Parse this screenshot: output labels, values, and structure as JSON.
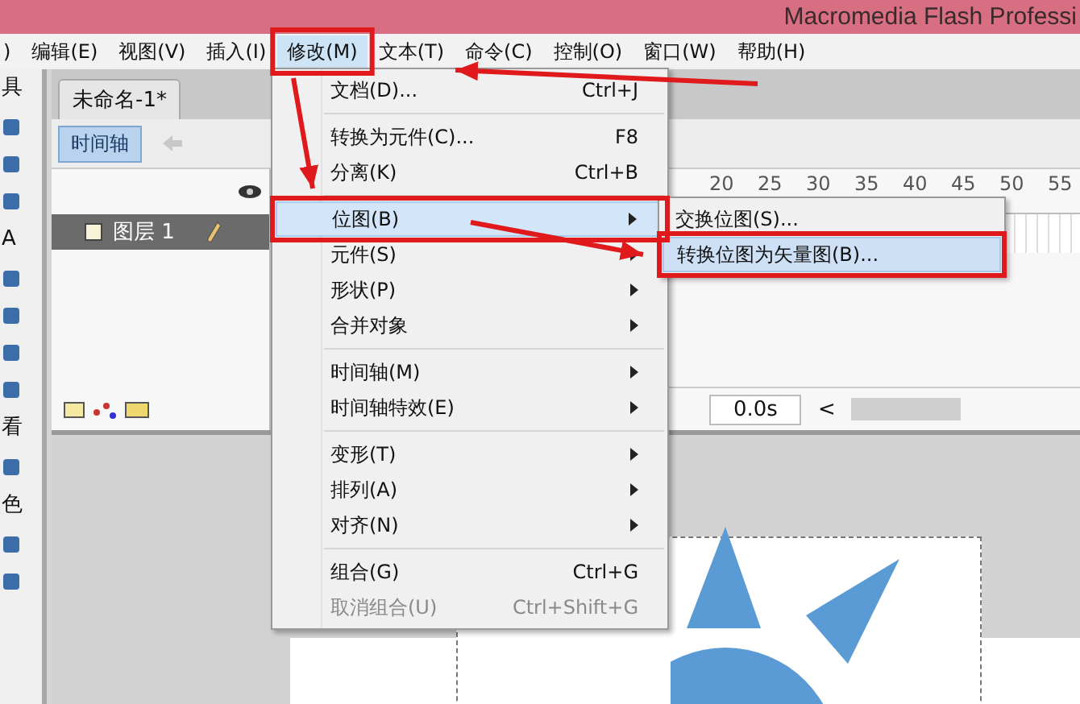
{
  "window": {
    "title": "Macromedia Flash Professi"
  },
  "menubar": [
    {
      "label": ")",
      "selected": false
    },
    {
      "label": "编辑(E)",
      "selected": false
    },
    {
      "label": "视图(V)",
      "selected": false
    },
    {
      "label": "插入(I)",
      "selected": false
    },
    {
      "label": "修改(M)",
      "selected": true
    },
    {
      "label": "文本(T)",
      "selected": false
    },
    {
      "label": "命令(C)",
      "selected": false
    },
    {
      "label": "控制(O)",
      "selected": false
    },
    {
      "label": "窗口(W)",
      "selected": false
    },
    {
      "label": "帮助(H)",
      "selected": false
    }
  ],
  "toolbox": [
    {
      "kind": "label",
      "text": "具"
    },
    {
      "kind": "tool"
    },
    {
      "kind": "tool"
    },
    {
      "kind": "tool"
    },
    {
      "kind": "label",
      "text": "A"
    },
    {
      "kind": "tool"
    },
    {
      "kind": "tool"
    },
    {
      "kind": "tool"
    },
    {
      "kind": "tool"
    },
    {
      "kind": "label",
      "text": "看"
    },
    {
      "kind": "tool"
    },
    {
      "kind": "label",
      "text": "色"
    },
    {
      "kind": "tool"
    },
    {
      "kind": "tool"
    }
  ],
  "document_tab": {
    "label": "未命名-1*"
  },
  "timeline": {
    "button": "时间轴",
    "ruler": [
      "20",
      "25",
      "30",
      "35",
      "40",
      "45",
      "50",
      "55"
    ],
    "layers": [
      {
        "name": "图层 1",
        "selected": true
      }
    ],
    "elapsed_time": "0.0s",
    "scroll_left": "<"
  },
  "menu": {
    "items": [
      {
        "kind": "command",
        "label": "文档(D)...",
        "shortcut": "Ctrl+J",
        "selected": false,
        "disabled": false
      },
      {
        "kind": "separator"
      },
      {
        "kind": "command",
        "label": "转换为元件(C)...",
        "shortcut": "F8",
        "selected": false,
        "disabled": false
      },
      {
        "kind": "command",
        "label": "分离(K)",
        "shortcut": "Ctrl+B",
        "selected": false,
        "disabled": false
      },
      {
        "kind": "separator"
      },
      {
        "kind": "submenu",
        "label": "位图(B)",
        "selected": true,
        "disabled": false
      },
      {
        "kind": "submenu",
        "label": "元件(S)",
        "selected": false,
        "disabled": false
      },
      {
        "kind": "submenu",
        "label": "形状(P)",
        "selected": false,
        "disabled": false
      },
      {
        "kind": "submenu",
        "label": "合并对象",
        "selected": false,
        "disabled": false
      },
      {
        "kind": "separator"
      },
      {
        "kind": "submenu",
        "label": "时间轴(M)",
        "selected": false,
        "disabled": false
      },
      {
        "kind": "submenu",
        "label": "时间轴特效(E)",
        "selected": false,
        "disabled": false
      },
      {
        "kind": "separator"
      },
      {
        "kind": "submenu",
        "label": "变形(T)",
        "selected": false,
        "disabled": false
      },
      {
        "kind": "submenu",
        "label": "排列(A)",
        "selected": false,
        "disabled": false
      },
      {
        "kind": "submenu",
        "label": "对齐(N)",
        "selected": false,
        "disabled": false
      },
      {
        "kind": "separator"
      },
      {
        "kind": "command",
        "label": "组合(G)",
        "shortcut": "Ctrl+G",
        "selected": false,
        "disabled": false
      },
      {
        "kind": "command",
        "label": "取消组合(U)",
        "shortcut": "Ctrl+Shift+G",
        "selected": false,
        "disabled": true
      }
    ]
  },
  "submenu": {
    "items": [
      {
        "label": "交换位图(S)...",
        "selected": false
      },
      {
        "label": "转换位图为矢量图(B)...",
        "selected": true
      }
    ]
  }
}
